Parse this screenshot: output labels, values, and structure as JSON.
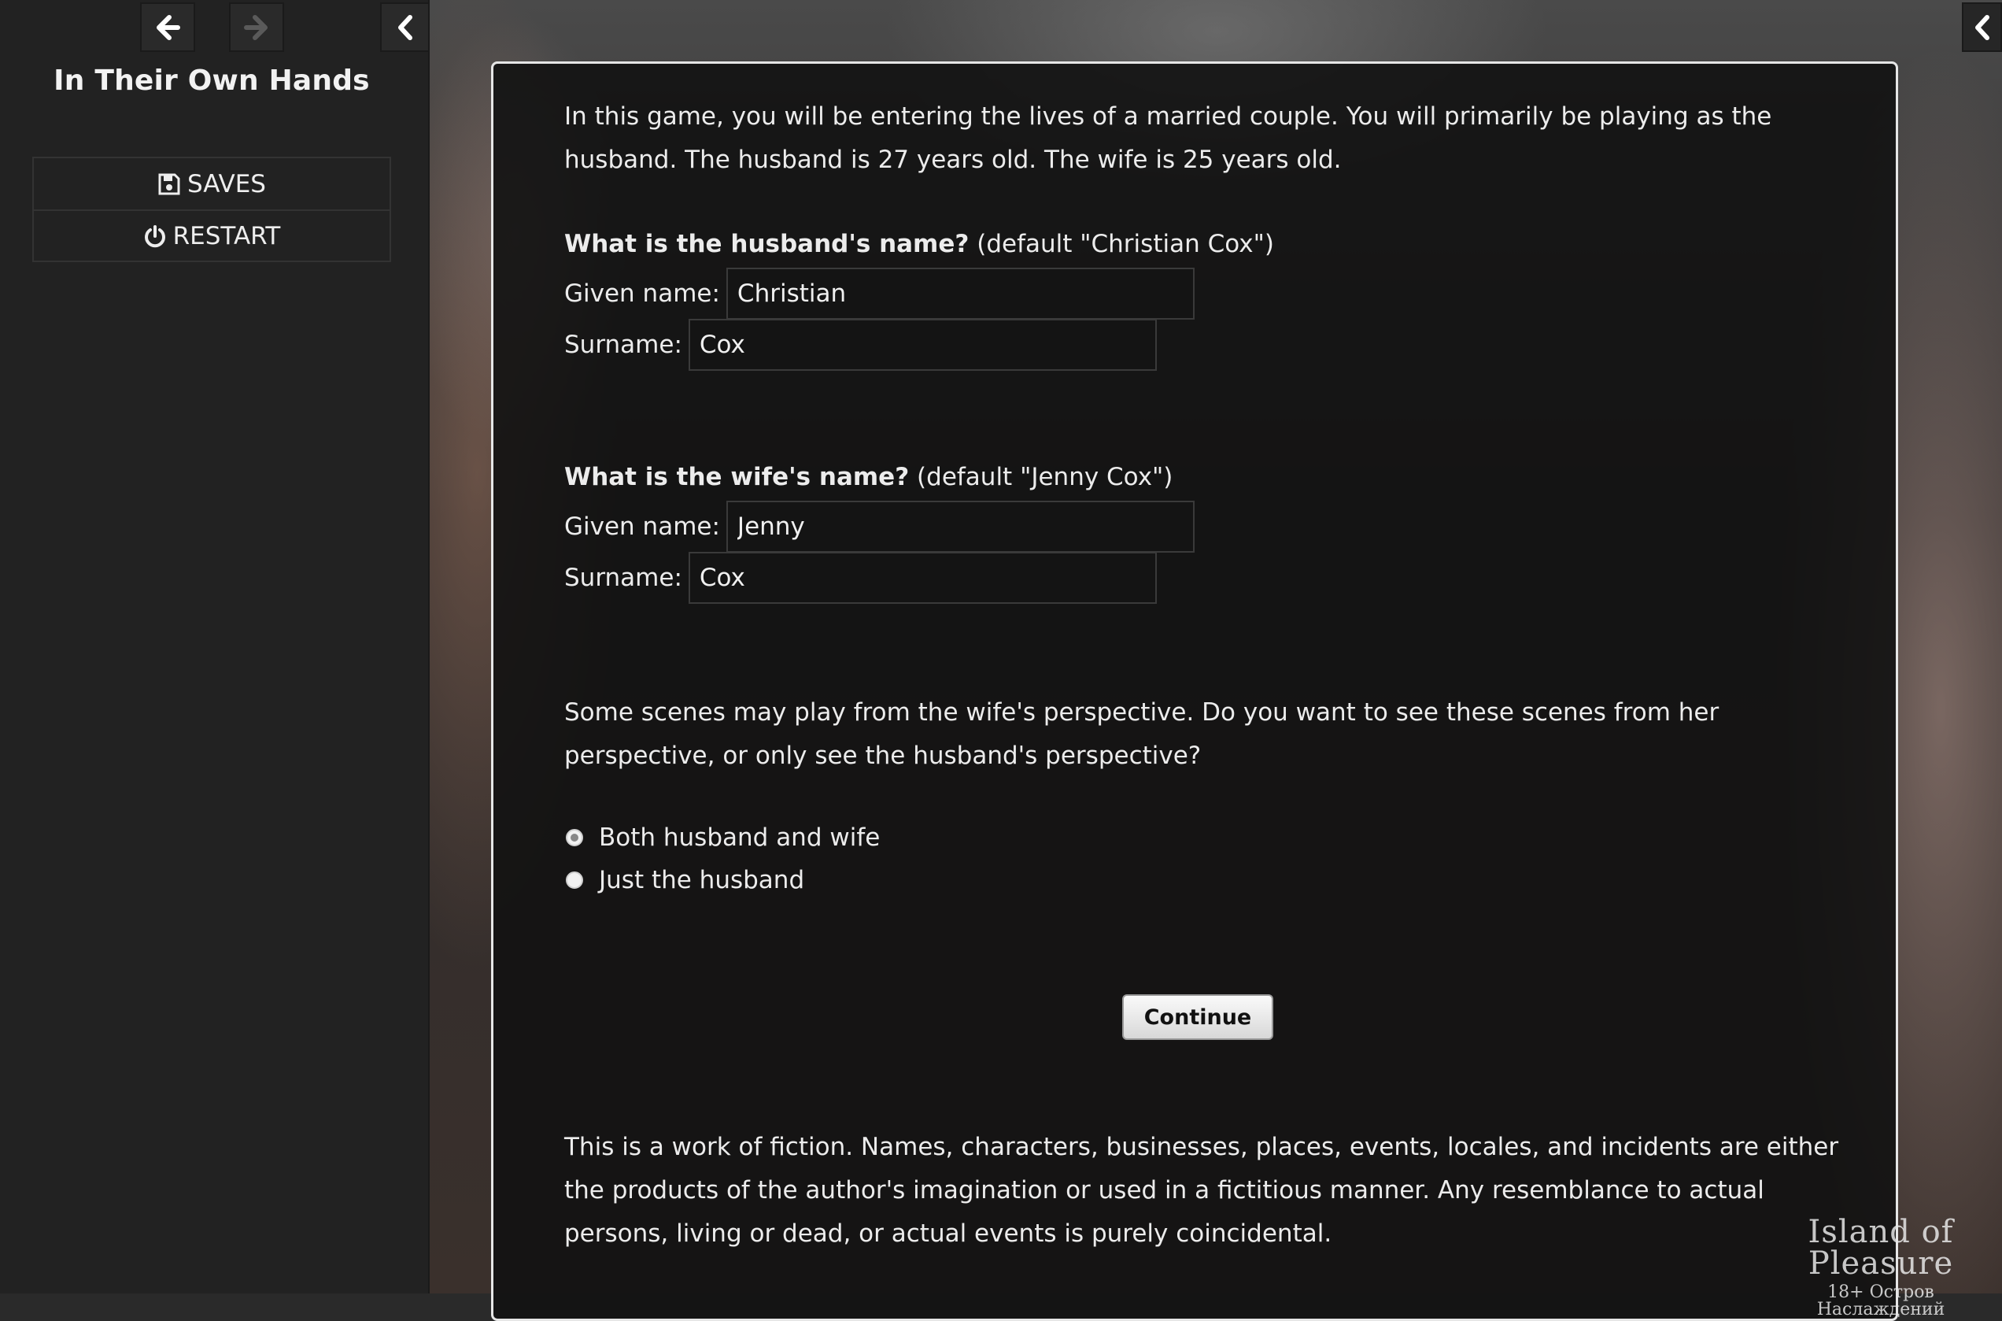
{
  "sidebar": {
    "title": "In Their Own Hands",
    "menu": [
      {
        "label": "SAVES",
        "icon": "floppy-disk-icon"
      },
      {
        "label": "RESTART",
        "icon": "power-icon"
      }
    ]
  },
  "passage": {
    "intro": "In this game, you will be entering the lives of a married couple. You will primarily be playing as the husband. The husband is 27 years old. The wife is 25 years old.",
    "husband": {
      "question_bold": "What is the husband's name?",
      "question_default": "(default \"Christian Cox\")",
      "given_label": "Given name:",
      "given_value": "Christian",
      "surname_label": "Surname:",
      "surname_value": "Cox"
    },
    "wife": {
      "question_bold": "What is the wife's name?",
      "question_default": "(default \"Jenny Cox\")",
      "given_label": "Given name:",
      "given_value": "Jenny",
      "surname_label": "Surname:",
      "surname_value": "Cox"
    },
    "perspective_text": "Some scenes may play from the wife's perspective. Do you want to see these scenes from her perspective, or only see the husband's perspective?",
    "options": [
      {
        "label": "Both husband and wife",
        "checked": true
      },
      {
        "label": "Just the husband",
        "checked": false
      }
    ],
    "continue_label": "Continue",
    "disclaimer": "This is a work of fiction. Names, characters, businesses, places, events, locales, and incidents are either the products of the author's imagination or used in a fictitious manner. Any resemblance to actual persons, living or dead, or actual events is purely coincidental."
  },
  "watermark": {
    "title": "Island of Pleasure",
    "subtitle": "18+ Остров Наслаждений"
  },
  "colors": {
    "sidebar_bg": "#222222",
    "panel_bg": "#121212",
    "panel_border": "#e6e6e6",
    "text": "#ececec"
  }
}
